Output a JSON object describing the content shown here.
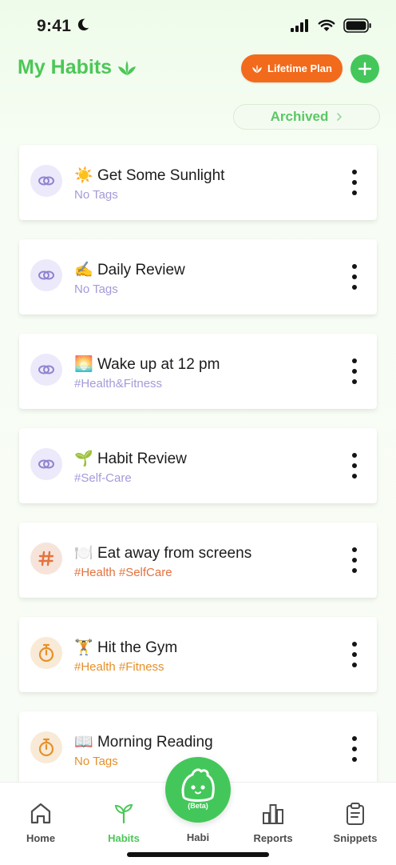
{
  "status_bar": {
    "time": "9:41"
  },
  "header": {
    "title": "My Habits",
    "plan_label": "Lifetime Plan",
    "archived_label": "Archived"
  },
  "habits": [
    {
      "emoji": "☀️",
      "name": "Get Some Sunlight",
      "tags": "No Tags",
      "color": "purple",
      "icon": "link-rings-icon"
    },
    {
      "emoji": "✍️",
      "name": "Daily Review",
      "tags": "No Tags",
      "color": "purple",
      "icon": "link-rings-icon"
    },
    {
      "emoji": "🌅",
      "name": "Wake up at 12 pm",
      "tags": "#Health&Fitness",
      "color": "purple",
      "icon": "link-rings-icon"
    },
    {
      "emoji": "🌱",
      "name": "Habit Review",
      "tags": "#Self-Care",
      "color": "purple",
      "icon": "link-rings-icon"
    },
    {
      "emoji": "🍽️",
      "name": "Eat away from screens",
      "tags": "#Health #SelfCare",
      "color": "peach",
      "icon": "hashtag-icon"
    },
    {
      "emoji": "🏋️",
      "name": "Hit the Gym",
      "tags": "#Health #Fitness",
      "color": "orange",
      "icon": "stopwatch-icon"
    },
    {
      "emoji": "📖",
      "name": "Morning Reading",
      "tags": "No Tags",
      "color": "orange",
      "icon": "stopwatch-icon"
    }
  ],
  "bottom_nav": {
    "home": "Home",
    "habits": "Habits",
    "habi": "Habi",
    "habi_badge": "(Beta)",
    "reports": "Reports",
    "snippets": "Snippets"
  },
  "colors": {
    "brand_green": "#44c75a",
    "plan_orange": "#f26a1b",
    "tag_purple": "#a49ad8",
    "tag_peach": "#e4723e",
    "tag_orange": "#e6902b"
  }
}
